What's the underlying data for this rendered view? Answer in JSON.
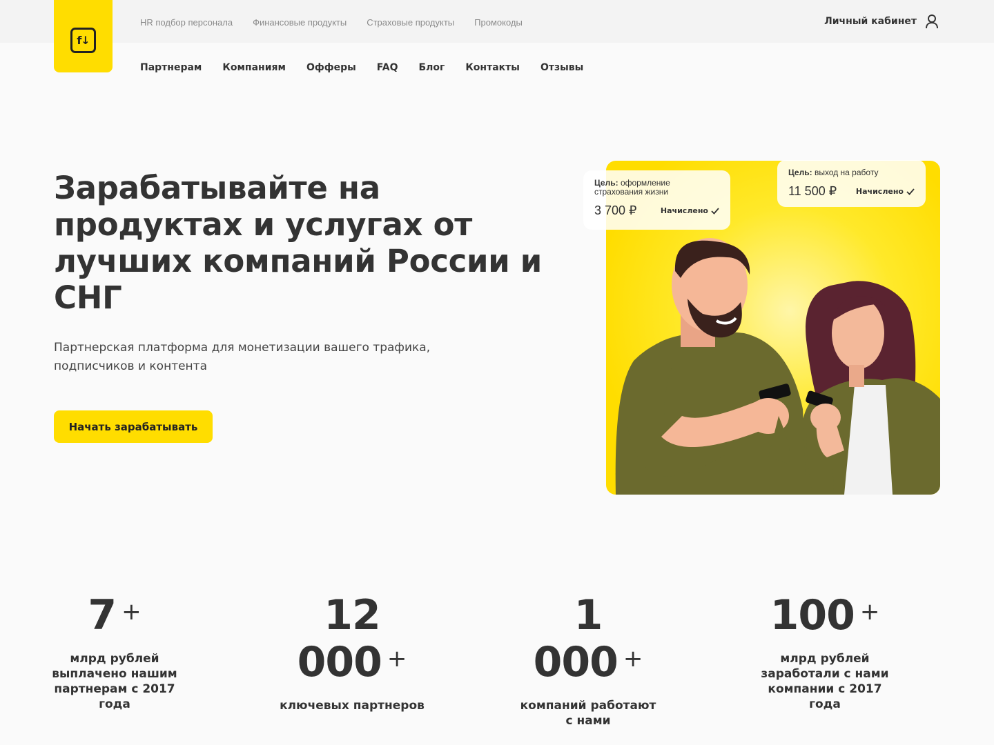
{
  "logo": {
    "mark": "f↓"
  },
  "topnav": [
    "HR подбор персонала",
    "Финансовые продукты",
    "Страховые продукты",
    "Промокоды"
  ],
  "account": {
    "label": "Личный кабинет",
    "icon": "user-icon"
  },
  "mainnav": [
    "Партнерам",
    "Компаниям",
    "Офферы",
    "FAQ",
    "Блог",
    "Контакты",
    "Отзывы"
  ],
  "hero": {
    "title": "Зарабатывайте на продуктах и услугах от лучших компаний России и СНГ",
    "subtitle": "Партнерская платформа для монетизации вашего трафика, подписчиков и контента",
    "cta": "Начать зарабатывать"
  },
  "cards": [
    {
      "goal_label": "Цель:",
      "goal_text": "оформление страхования жизни",
      "amount": "3 700 ₽",
      "status": "Начислено"
    },
    {
      "goal_label": "Цель:",
      "goal_text": "выход на работу",
      "amount": "11 500 ₽",
      "status": "Начислено"
    }
  ],
  "stats": [
    {
      "num": "7",
      "plus": "+",
      "label": "млрд рублей выплачено нашим партнерам с 2017 года"
    },
    {
      "num": "12 000",
      "plus": "+",
      "label": "ключевых партнеров"
    },
    {
      "num": "1 000",
      "plus": "+",
      "label": "компаний работают с нами"
    },
    {
      "num": "100",
      "plus": "+",
      "label": "млрд рублей заработали с нами компании с 2017 года"
    }
  ],
  "colors": {
    "accent": "#ffdd00",
    "text": "#333333",
    "topbar": "#f3f3f3"
  }
}
